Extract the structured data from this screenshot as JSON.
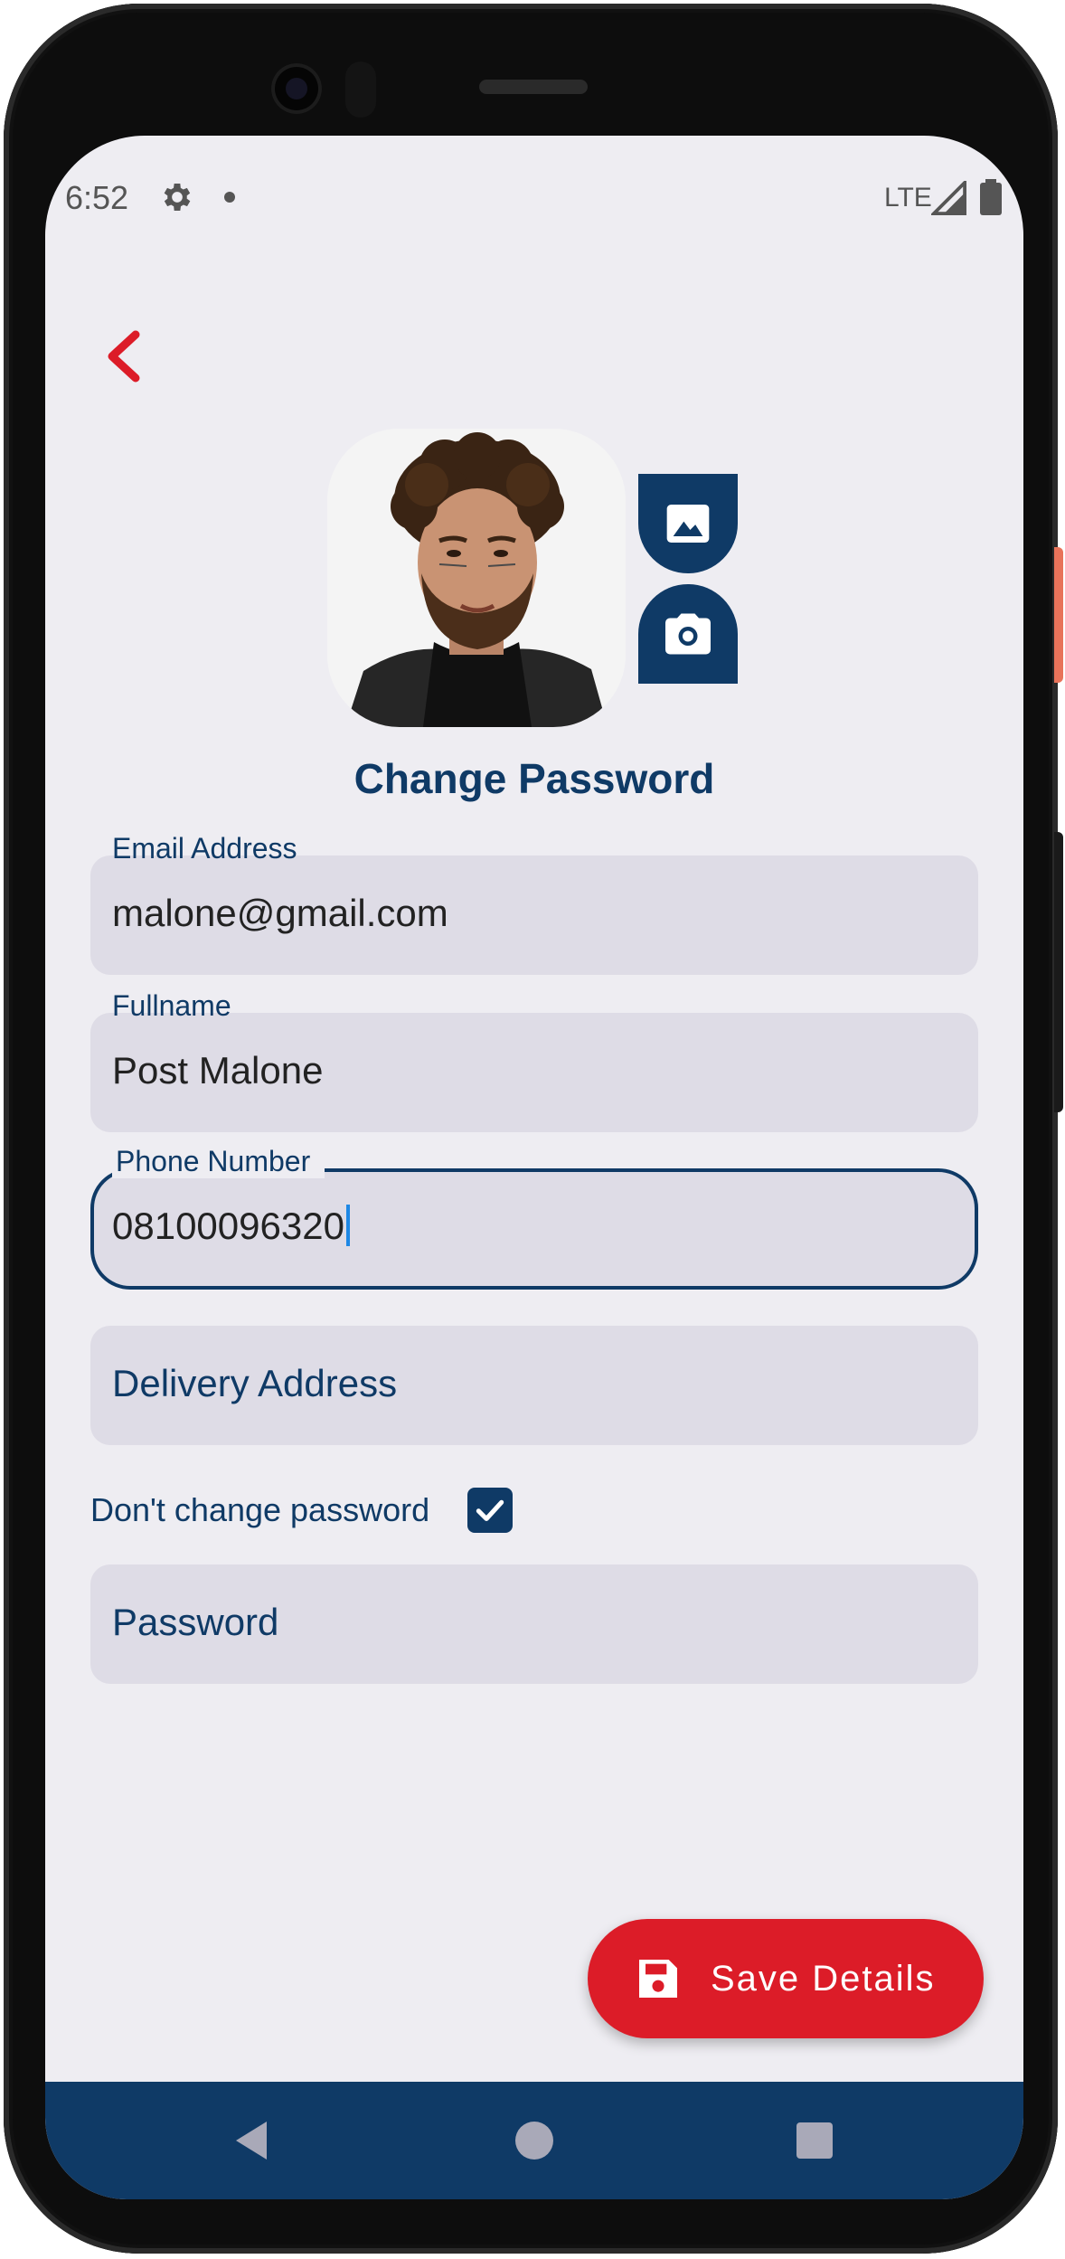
{
  "status_bar": {
    "time": "6:52",
    "network": "LTE",
    "icons": [
      "gear-icon",
      "dot-icon",
      "signal-icon",
      "battery-icon"
    ]
  },
  "header": {
    "back_icon": "chevron-left-icon",
    "title": "Change Password"
  },
  "avatar": {
    "gallery_icon": "image-icon",
    "camera_icon": "camera-icon"
  },
  "form": {
    "email": {
      "label": "Email Address",
      "value": "malone@gmail.com"
    },
    "fullname": {
      "label": "Fullname",
      "value": "Post Malone"
    },
    "phone": {
      "label": "Phone Number",
      "value": "08100096320"
    },
    "address": {
      "placeholder": "Delivery Address"
    },
    "dont_change_password": {
      "label": "Don't change password",
      "checked": true
    },
    "password": {
      "placeholder": "Password"
    }
  },
  "save_button": {
    "label": "Save Details",
    "icon": "save-icon"
  },
  "nav_bar": {
    "icons": [
      "back-triangle-icon",
      "home-circle-icon",
      "recents-square-icon"
    ]
  },
  "colors": {
    "primary": "#0f3a66",
    "accent": "#dc1c28",
    "background": "#eeedf2",
    "field_fill": "#dedce6"
  }
}
